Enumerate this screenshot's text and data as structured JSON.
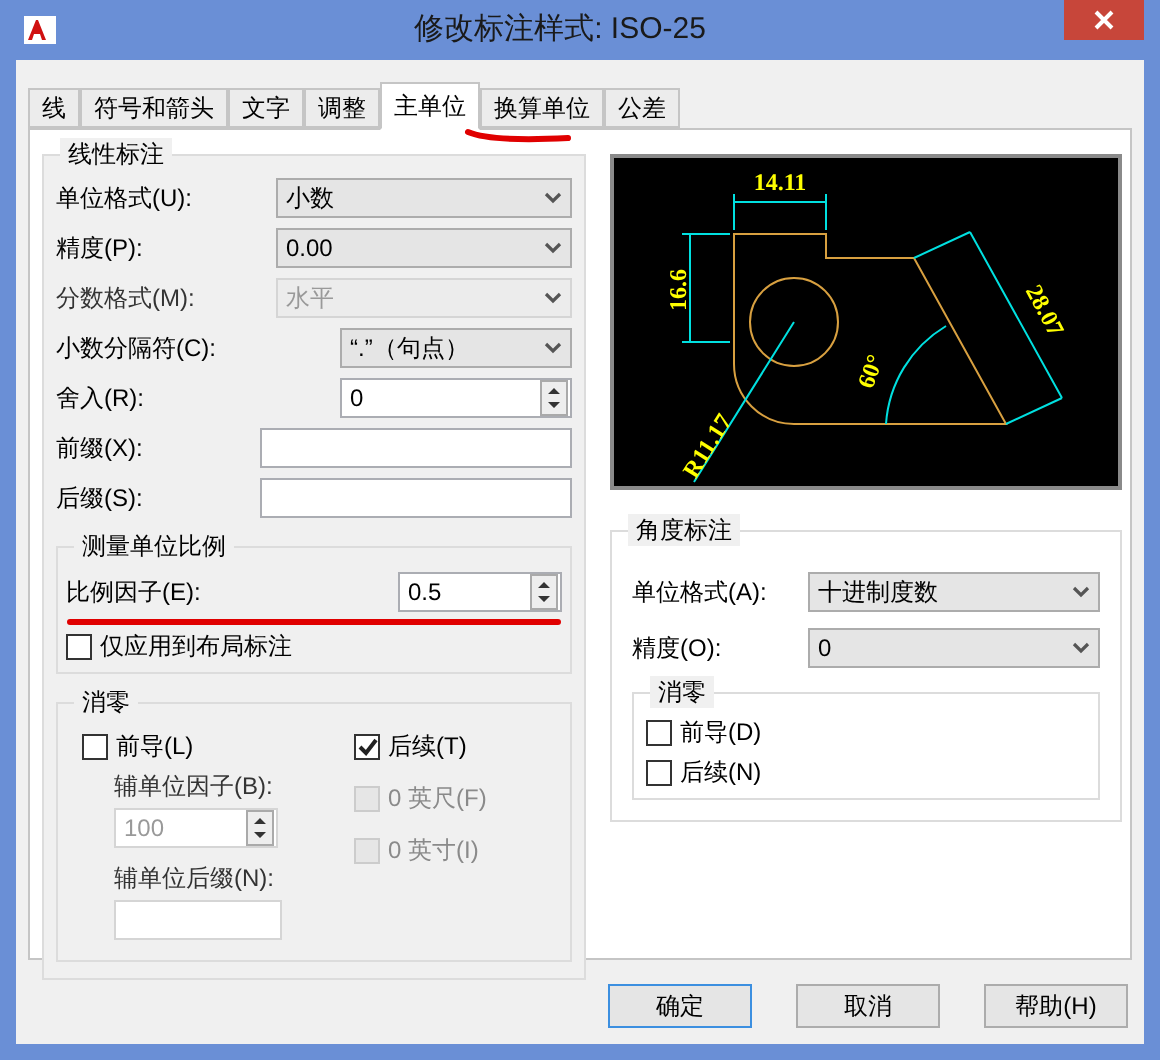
{
  "window": {
    "title": "修改标注样式: ISO-25"
  },
  "tabs": [
    {
      "label": "线",
      "selected": false
    },
    {
      "label": "符号和箭头",
      "selected": false
    },
    {
      "label": "文字",
      "selected": false
    },
    {
      "label": "调整",
      "selected": false
    },
    {
      "label": "主单位",
      "selected": true
    },
    {
      "label": "换算单位",
      "selected": false
    },
    {
      "label": "公差",
      "selected": false
    }
  ],
  "linear": {
    "title": "线性标注",
    "fields": [
      {
        "label": "单位格式(U):",
        "kind": "select",
        "value": "小数",
        "disabled": false
      },
      {
        "label": "精度(P):",
        "kind": "select",
        "value": "0.00",
        "disabled": false
      },
      {
        "label": "分数格式(M):",
        "kind": "select",
        "value": "水平",
        "disabled": true
      },
      {
        "label": "小数分隔符(C):",
        "kind": "select_narrow",
        "value": "“.”（句点）",
        "disabled": false
      },
      {
        "label": "舍入(R):",
        "kind": "spin",
        "value": "0",
        "disabled": false
      },
      {
        "label": "前缀(X):",
        "kind": "input",
        "disabled": false
      },
      {
        "label": "后缀(S):",
        "kind": "input",
        "disabled": false
      }
    ]
  },
  "scale": {
    "title": "测量单位比例",
    "factor": {
      "label": "比例因子(E):",
      "value": "0.5"
    },
    "layout_only": {
      "label": "仅应用到布局标注",
      "checked": false
    }
  },
  "zero": {
    "title": "消零",
    "leading": {
      "label": "前导(L)",
      "checked": false
    },
    "trailing": {
      "label": "后续(T)",
      "checked": true
    },
    "sub_factor": {
      "label": "辅单位因子(B):",
      "value": "100",
      "disabled": true
    },
    "sub_suffix": {
      "label": "辅单位后缀(N):",
      "disabled": true
    },
    "feet": {
      "label": "0 英尺(F)",
      "checked": false,
      "disabled": true
    },
    "inches": {
      "label": "0 英寸(I)",
      "checked": false,
      "disabled": true
    }
  },
  "preview": {
    "labels": [
      "14.11",
      "16.6",
      "R11.17",
      "60°",
      "28.07"
    ]
  },
  "angular": {
    "title": "角度标注",
    "unit_format": {
      "label": "单位格式(A):",
      "value": "十进制度数"
    },
    "precision": {
      "label": "精度(O):",
      "value": "0"
    },
    "zero": {
      "title": "消零",
      "leading": {
        "label": "前导(D)",
        "checked": false
      },
      "trailing": {
        "label": "后续(N)",
        "checked": false
      }
    }
  },
  "buttons": [
    {
      "label": "确定",
      "selected": true
    },
    {
      "label": "取消",
      "selected": false
    },
    {
      "label": "帮助(H)",
      "selected": false
    }
  ]
}
